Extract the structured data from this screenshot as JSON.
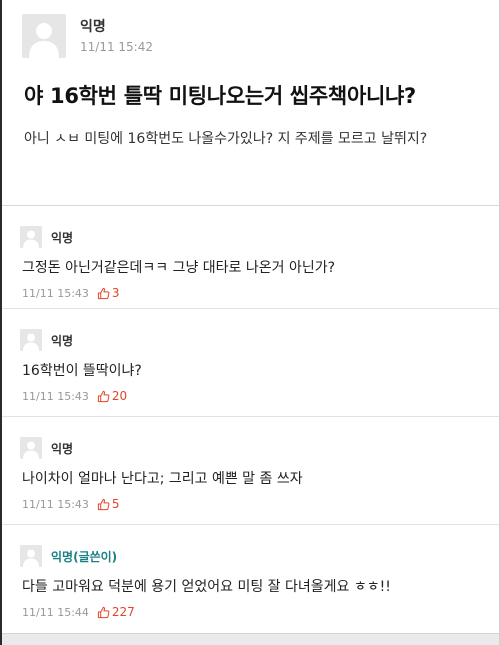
{
  "post": {
    "author": "익명",
    "time": "11/11 15:42",
    "title": "야 16학번 틀딱 미팅나오는거 씹주책아니냐?",
    "body": "아니 ㅅㅂ 미팅에 16학번도 나올수가있나? 지 주제를 모르고 날뛰지?"
  },
  "comments": [
    {
      "author": "익명",
      "text": "그정돈 아닌거같은데ㅋㅋ 그냥 대타로 나온거 아닌가?",
      "time": "11/11 15:43",
      "likes": "3",
      "is_writer": false
    },
    {
      "author": "익명",
      "text": "16학번이 뜰딱이냐?",
      "time": "11/11 15:43",
      "likes": "20",
      "is_writer": false
    },
    {
      "author": "익명",
      "text": "나이차이 얼마나 난다고; 그리고 예쁜 말 좀 쓰자",
      "time": "11/11 15:43",
      "likes": "5",
      "is_writer": false
    },
    {
      "author": "익명(글쓴이)",
      "text": "다들 고마워요 덕분에 용기 얻었어요 미팅 잘 다녀올게요 ㅎㅎ!!",
      "time": "11/11 15:44",
      "likes": "227",
      "is_writer": true
    }
  ],
  "colors": {
    "like": "#e2462a",
    "writer": "#1b7f86",
    "meta": "#999999"
  }
}
